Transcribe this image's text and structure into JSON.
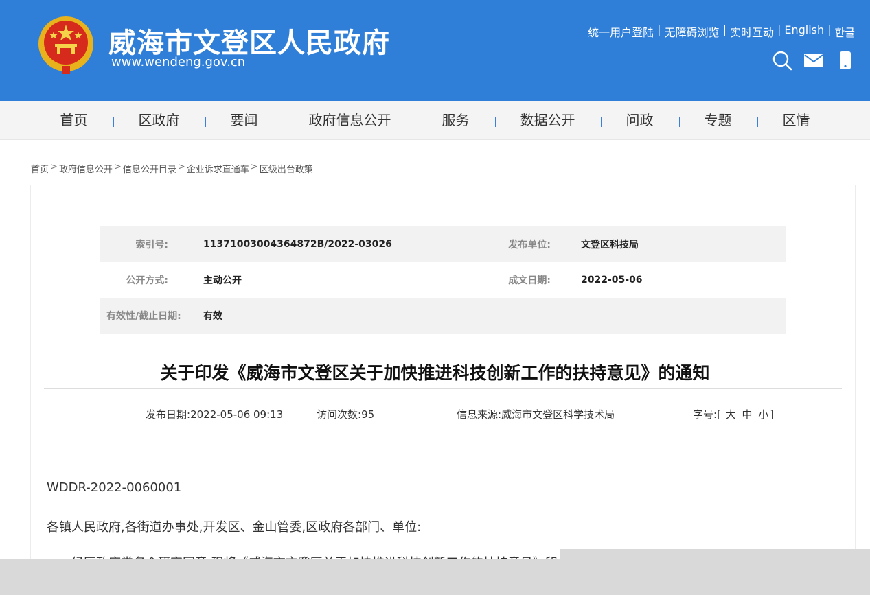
{
  "header": {
    "site_title": "威海市文登区人民政府",
    "site_url": "www.wendeng.gov.cn",
    "background_color": "#2f7fd9",
    "top_links": [
      "统一用户登陆",
      "无障碍浏览",
      "实时互动",
      "English",
      "한글"
    ],
    "separator": "|",
    "icons": [
      "search-icon",
      "mail-icon",
      "mobile-icon"
    ]
  },
  "nav": {
    "items": [
      "首页",
      "区政府",
      "要闻",
      "政府信息公开",
      "服务",
      "数据公开",
      "问政",
      "专题",
      "区情"
    ]
  },
  "breadcrumb": {
    "items": [
      "首页",
      "政府信息公开",
      "信息公开目录",
      "企业诉求直通车",
      "区级出台政策"
    ],
    "separator": ">"
  },
  "meta": {
    "index_label": "索引号:",
    "index_value": "11371003004364872B/2022-03026",
    "publisher_label": "发布单位:",
    "publisher_value": "文登区科技局",
    "disclosure_label": "公开方式:",
    "disclosure_value": "主动公开",
    "created_label": "成文日期:",
    "created_value": "2022-05-06",
    "validity_label": "有效性/截止日期:",
    "validity_value": "有效"
  },
  "article": {
    "title": "关于印发《威海市文登区关于加快推进科技创新工作的扶持意见》的通知",
    "publish_date_label": "发布日期:",
    "publish_date": "2022-05-06 09:13",
    "visits_label": "访问次数:",
    "visits": "95",
    "source_label": "信息来源:",
    "source": "威海市文登区科学技术局",
    "font_size_label": "字号:",
    "font_size_open": "[",
    "font_size_options": [
      "大",
      "中",
      "小"
    ],
    "font_size_close": "]",
    "doc_number": "WDDR-2022-0060001",
    "recipients": "各镇人民政府,各街道办事处,开发区、金山管委,区政府各部门、单位:",
    "body_first_line": "经区政府常务会研究同意,现将《威海市文登区关于加快推进科技创新工作的扶持意见》印"
  },
  "colors": {
    "accent": "#2f7fd9",
    "nav_bg": "#f4f4f4",
    "overlay": "#d9d9d9"
  }
}
